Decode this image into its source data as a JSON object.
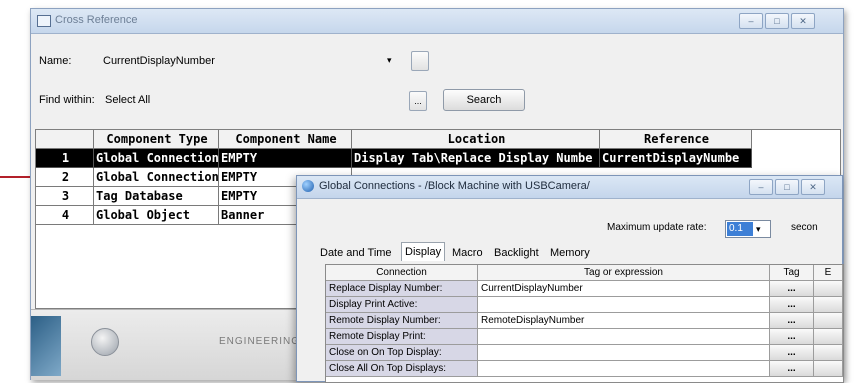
{
  "cross_reference": {
    "title": "Cross Reference",
    "controls": {
      "minimize": "–",
      "maximize": "□",
      "close": "✕"
    },
    "name_label": "Name:",
    "name_value": "CurrentDisplayNumber",
    "find_within_label": "Find within:",
    "find_within_value": "Select All",
    "ellipsis": "...",
    "search_button": "Search",
    "columns": [
      "Component Type",
      "Component Name",
      "Location",
      "Reference"
    ],
    "rows": [
      {
        "num": "1",
        "type": "Global Connection",
        "name": "EMPTY",
        "location": "Display Tab\\Replace Display Numbe",
        "reference": "CurrentDisplayNumbe"
      },
      {
        "num": "2",
        "type": "Global Connection",
        "name": "EMPTY",
        "location": "",
        "reference": ""
      },
      {
        "num": "3",
        "type": "Tag Database",
        "name": "EMPTY",
        "location": "",
        "reference": ""
      },
      {
        "num": "4",
        "type": "Global Object",
        "name": "Banner",
        "location": "",
        "reference": ""
      }
    ],
    "footer_text": "ENGINEERING"
  },
  "global_connections": {
    "title": "Global Connections - /Block Machine with USBCamera/",
    "controls": {
      "minimize": "–",
      "maximize": "□",
      "close": "✕"
    },
    "max_update_rate_label": "Maximum update rate:",
    "max_update_rate_value": "0.1",
    "seconds_label": "secon",
    "tabs": [
      "Date and Time",
      "Display",
      "Macro",
      "Backlight",
      "Memory"
    ],
    "active_tab": "Display",
    "columns": [
      "Connection",
      "Tag or expression",
      "Tag",
      "E"
    ],
    "ellipsis": "...",
    "rows": [
      {
        "connection": "Replace Display Number:",
        "tag": "CurrentDisplayNumber"
      },
      {
        "connection": "Display Print Active:",
        "tag": ""
      },
      {
        "connection": "Remote Display Number:",
        "tag": "RemoteDisplayNumber"
      },
      {
        "connection": "Remote Display Print:",
        "tag": ""
      },
      {
        "connection": "Close on On Top Display:",
        "tag": ""
      },
      {
        "connection": "Close All On Top Displays:",
        "tag": ""
      }
    ]
  },
  "colors": {
    "selection": "#000000",
    "callout": "#b3202a",
    "title_bar": "#c6d7ec",
    "dropdown_highlight": "#3d7fd6"
  }
}
